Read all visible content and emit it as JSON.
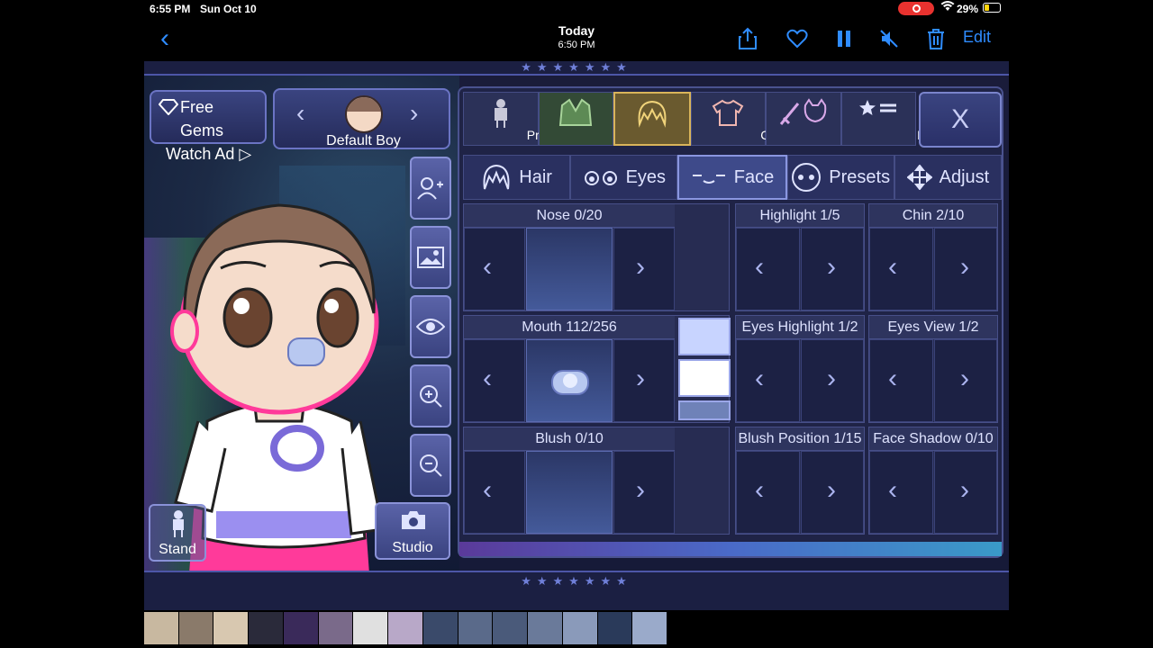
{
  "status": {
    "time": "6:55 PM",
    "date": "Sun Oct 10",
    "battery": "29%"
  },
  "nav": {
    "title": "Today",
    "subtitle": "6:50 PM",
    "edit": "Edit"
  },
  "game": {
    "stars": "★★★★★★★",
    "gems": {
      "line1": "Free Gems",
      "line2": "Watch Ad ▷"
    },
    "character": {
      "name": "Default Boy",
      "prev": "‹",
      "next": "›"
    },
    "stand": "Stand",
    "studio": "Studio",
    "tabs": [
      "Presets",
      "Body",
      "Head",
      "Clothes",
      "Other",
      "Profile"
    ],
    "active_tab": "Head",
    "close": "X",
    "subtabs": [
      "Hair",
      "Eyes",
      "Face",
      "Presets",
      "Adjust"
    ],
    "active_subtab": "Face",
    "sections": {
      "nose": "Nose 0/20",
      "highlight": "Highlight 1/5",
      "chin": "Chin 2/10",
      "mouth": "Mouth 112/256",
      "eyes_highlight": "Eyes Highlight 1/2",
      "eyes_view": "Eyes View 1/2",
      "blush": "Blush 0/10",
      "blush_position": "Blush Position 1/15",
      "face_shadow": "Face Shadow 0/10"
    },
    "swatch_colors": [
      "#c8d4ff",
      "#ffffff",
      "#6f82b8"
    ]
  }
}
